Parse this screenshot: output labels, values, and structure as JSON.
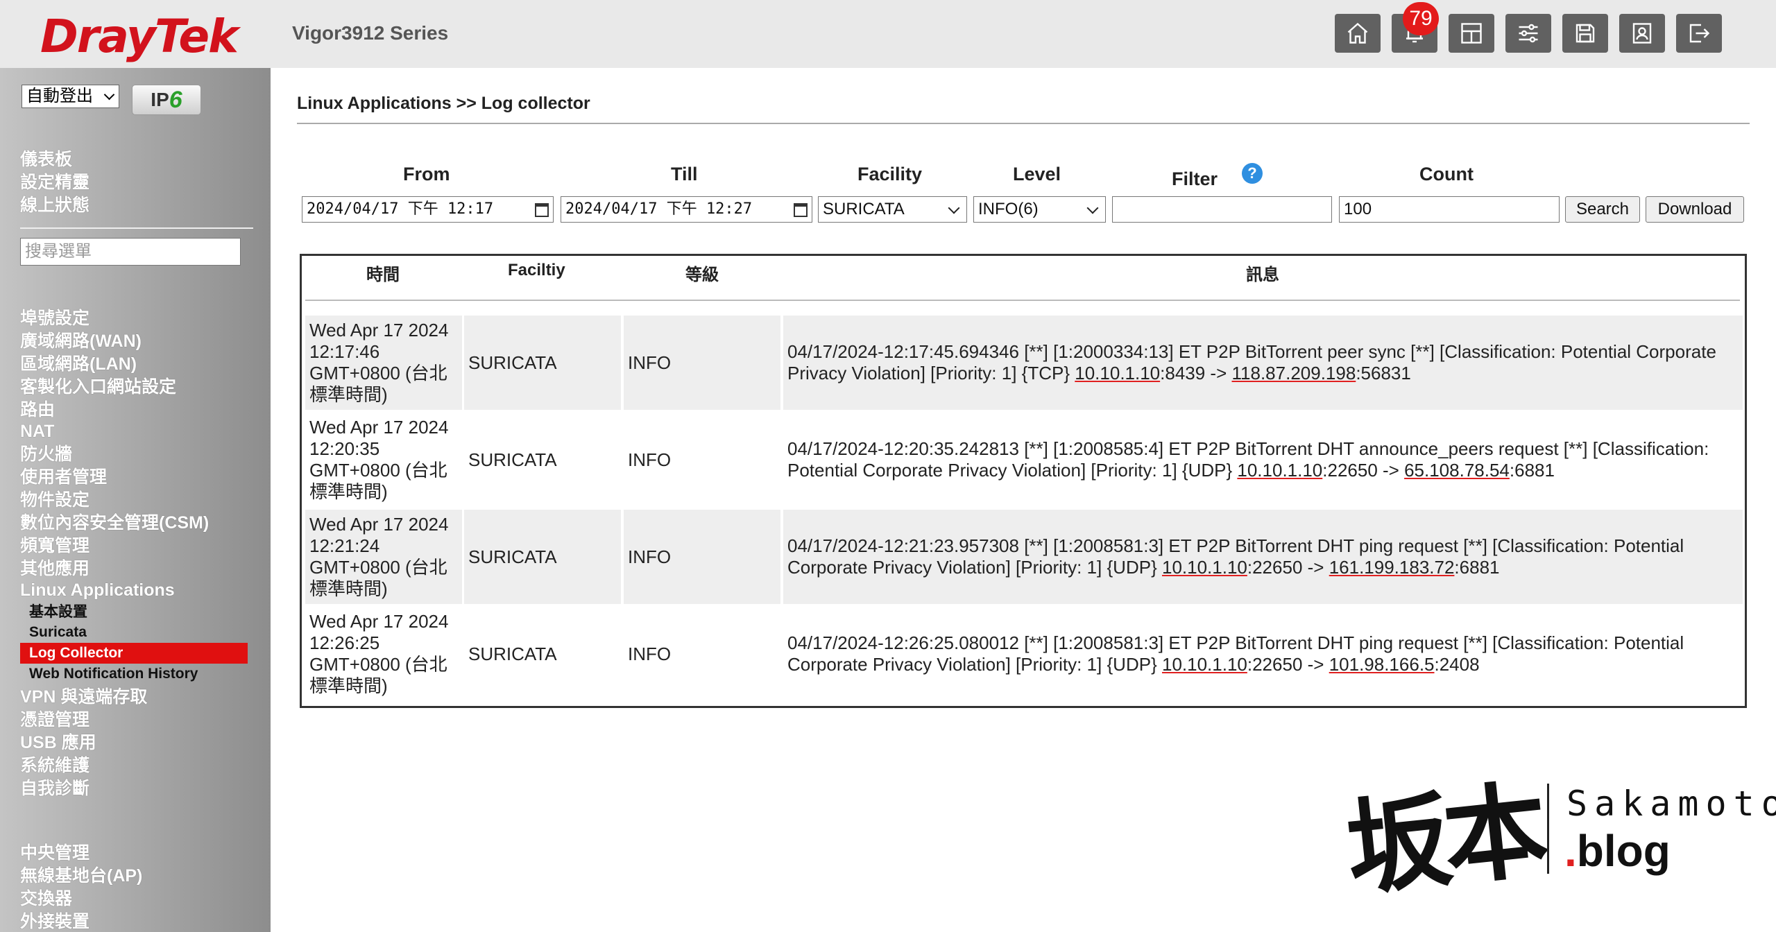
{
  "header": {
    "brand": "DrayTek",
    "model": "Vigor3912 Series",
    "notification_count": "79",
    "icons": [
      "home-icon",
      "bell-icon",
      "dashboard-layout-icon",
      "sliders-icon",
      "save-icon",
      "profile-icon",
      "logout-icon"
    ]
  },
  "sidebar": {
    "logout_select": "自動登出",
    "ipv6_badge_prefix": "IP",
    "ipv6_badge_suffix": "6",
    "top_items": [
      "儀表板",
      "設定精靈",
      "線上狀態"
    ],
    "search_placeholder": "搜尋選單",
    "items": [
      "埠號設定",
      "廣域網路(WAN)",
      "區域網路(LAN)",
      "客製化入口網站設定",
      "路由",
      "NAT",
      "防火牆",
      "使用者管理",
      "物件設定",
      "數位內容安全管理(CSM)",
      "頻寬管理",
      "其他應用",
      "Linux Applications"
    ],
    "sub_items": [
      "基本設置",
      "Suricata",
      "Log Collector",
      "Web Notification History"
    ],
    "items_after": [
      "VPN 與遠端存取",
      "憑證管理",
      "USB 應用",
      "系統維護",
      "自我診斷"
    ],
    "bottom_items": [
      "中央管理",
      "無線基地台(AP)",
      "交換器",
      "外接裝置"
    ]
  },
  "main": {
    "breadcrumb": "Linux Applications >> Log collector",
    "filters": {
      "from_label": "From",
      "from_value": "2024/04/17  下午  12:17",
      "till_label": "Till",
      "till_value": "2024/04/17  下午  12:27",
      "facility_label": "Facility",
      "facility_value": "SURICATA",
      "level_label": "Level",
      "level_value": "INFO(6)",
      "filter_label": "Filter",
      "filter_value": "",
      "count_label": "Count",
      "count_value": "100",
      "search_button": "Search",
      "download_button": "Download"
    },
    "table": {
      "headers": [
        "時間",
        "Faciltiy",
        "等級",
        "訊息"
      ],
      "rows": [
        {
          "time": [
            "Wed Apr 17 2024",
            "12:17:46",
            "GMT+0800 (台北",
            "標準時間)"
          ],
          "facility": "SURICATA",
          "level": "INFO",
          "msg_prefix": "04/17/2024-12:17:45.694346 [**] [1:2000334:13] ET P2P BitTorrent peer sync [**] [Classification: Potential Corporate Privacy Violation] [Priority: 1] {TCP} ",
          "src_ip": "10.10.1.10",
          "src_port": ":8439 -> ",
          "dst_ip": "118.87.209.198",
          "dst_port": ":56831"
        },
        {
          "time": [
            "Wed Apr 17 2024",
            "12:20:35",
            "GMT+0800 (台北",
            "標準時間)"
          ],
          "facility": "SURICATA",
          "level": "INFO",
          "msg_prefix": "04/17/2024-12:20:35.242813 [**] [1:2008585:4] ET P2P BitTorrent DHT announce_peers request [**] [Classification: Potential Corporate Privacy Violation] [Priority: 1] {UDP} ",
          "src_ip": "10.10.1.10",
          "src_port": ":22650 -> ",
          "dst_ip": "65.108.78.54",
          "dst_port": ":6881"
        },
        {
          "time": [
            "Wed Apr 17 2024",
            "12:21:24",
            "GMT+0800 (台北",
            "標準時間)"
          ],
          "facility": "SURICATA",
          "level": "INFO",
          "msg_prefix": "04/17/2024-12:21:23.957308 [**] [1:2008581:3] ET P2P BitTorrent DHT ping request [**] [Classification: Potential Corporate Privacy Violation] [Priority: 1] {UDP} ",
          "src_ip": "10.10.1.10",
          "src_port": ":22650 -> ",
          "dst_ip": "161.199.183.72",
          "dst_port": ":6881"
        },
        {
          "time": [
            "Wed Apr 17 2024",
            "12:26:25",
            "GMT+0800 (台北",
            "標準時間)"
          ],
          "facility": "SURICATA",
          "level": "INFO",
          "msg_prefix": "04/17/2024-12:26:25.080012 [**] [1:2008581:3] ET P2P BitTorrent DHT ping request [**] [Classification: Potential Corporate Privacy Violation] [Priority: 1] {UDP} ",
          "src_ip": "10.10.1.10",
          "src_port": ":22650 -> ",
          "dst_ip": "101.98.166.5",
          "dst_port": ":2408"
        }
      ]
    }
  },
  "watermark": {
    "kanji": "坂本",
    "name": "Sakamoto",
    "dot": ".",
    "blog": "blog"
  },
  "colors": {
    "brand_red": "#d2121c",
    "active_nav": "#e01010",
    "header_bg": "#e9e9e9",
    "row_alt": "#eeeeee",
    "icon_button": "#616161"
  }
}
